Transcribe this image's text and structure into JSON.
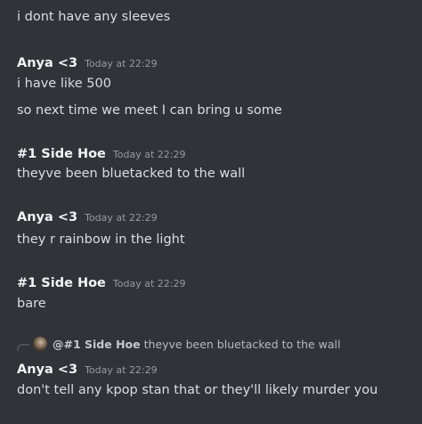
{
  "messages": {
    "m0": {
      "text": "i dont have any sleeves"
    },
    "m1": {
      "author": "Anya <3",
      "time": "Today at 22:29",
      "line1": "i have like 500",
      "line2": "so next time we meet I can bring u some"
    },
    "m2": {
      "author": "#1 Side Hoe",
      "time": "Today at 22:29",
      "line1": "theyve been bluetacked to the wall"
    },
    "m3": {
      "author": "Anya <3",
      "time": "Today at 22:29",
      "line1": "they r rainbow in the light"
    },
    "m4": {
      "author": "#1 Side Hoe",
      "time": "Today at 22:29",
      "line1": "bare"
    },
    "m5": {
      "reply": {
        "author": "@#1 Side Hoe",
        "text": "theyve been bluetacked to the wall"
      },
      "author": "Anya <3",
      "time": "Today at 22:29",
      "line1": "don't tell any kpop stan that or they'll likely murder you"
    }
  }
}
